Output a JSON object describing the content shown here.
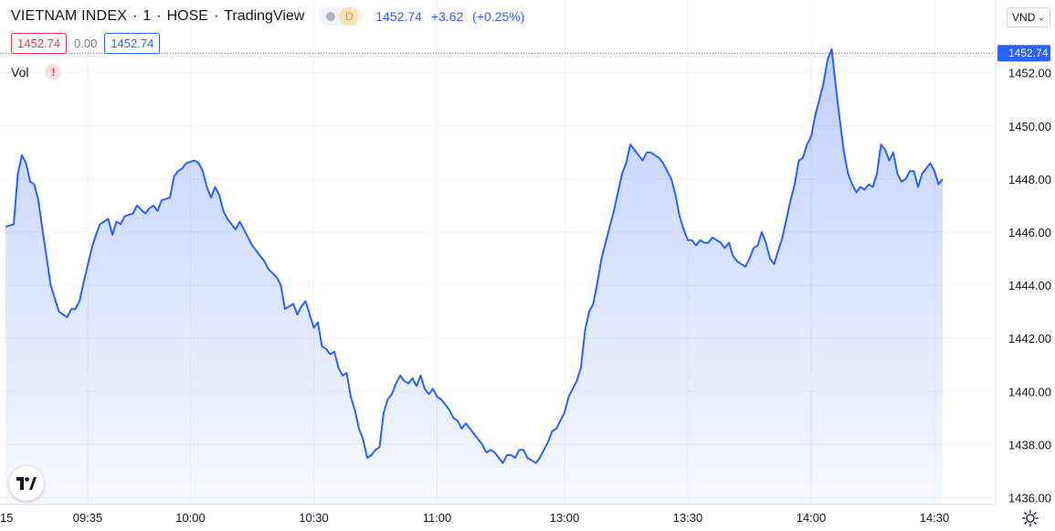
{
  "header": {
    "symbol": "VIETNAM INDEX",
    "interval": "1",
    "exchange": "HOSE",
    "provider": "TradingView",
    "badge_d": "D",
    "last": "1452.74",
    "change": "+3.62",
    "change_pct": "(+0.25%)",
    "price_box_red": "1452.74",
    "zero": "0.00",
    "price_box_blue": "1452.74",
    "vol_label": "Vol",
    "vol_warn": "!",
    "currency": "VND"
  },
  "colors": {
    "line": "#2962ff",
    "fill_top": "#2962ff",
    "grid": "#f0f3fa",
    "last_line": "#2962ff"
  },
  "chart_data": {
    "type": "area",
    "ylim": [
      1436.0,
      1453.2
    ],
    "y_ticks": [
      "1436.00",
      "1438.00",
      "1440.00",
      "1442.00",
      "1444.00",
      "1446.00",
      "1448.00",
      "1450.00",
      "1452.00"
    ],
    "x_ticks": [
      {
        "label": "15",
        "t": 0
      },
      {
        "label": "09:35",
        "t": 20
      },
      {
        "label": "10:00",
        "t": 45
      },
      {
        "label": "10:30",
        "t": 75
      },
      {
        "label": "11:00",
        "t": 105
      },
      {
        "label": "13:00",
        "t": 136
      },
      {
        "label": "13:30",
        "t": 166
      },
      {
        "label": "14:00",
        "t": 196
      },
      {
        "label": "14:30",
        "t": 226
      }
    ],
    "last_value_label": "1452.74",
    "last_value": 1452.74,
    "x": [
      0,
      2,
      3,
      4,
      5,
      6,
      7,
      8,
      9,
      11,
      13,
      15,
      16,
      17,
      18,
      19,
      21,
      22,
      23,
      25,
      26,
      27,
      28,
      29,
      31,
      32,
      34,
      35,
      36,
      37,
      38,
      40,
      41,
      42,
      43,
      44,
      46,
      47,
      48,
      49,
      50,
      51,
      52,
      53,
      54,
      56,
      57,
      58,
      59,
      60,
      61,
      62,
      63,
      64,
      66,
      67,
      68,
      69,
      70,
      71,
      72,
      73,
      75,
      76,
      77,
      78,
      79,
      80,
      81,
      82,
      83,
      84,
      85,
      86,
      87,
      88,
      89,
      90,
      91,
      92,
      93,
      94,
      95,
      96,
      97,
      98,
      99,
      100,
      101,
      102,
      103,
      104,
      105,
      106,
      107,
      108,
      109,
      110,
      111,
      112,
      113,
      114,
      115,
      116,
      117,
      118,
      119,
      120,
      121,
      122,
      123,
      124,
      125,
      126,
      127,
      128,
      129,
      130,
      131,
      132,
      133,
      134,
      135,
      136,
      137,
      138,
      139,
      140,
      141,
      142,
      143,
      144,
      145,
      146,
      147,
      148,
      149,
      150,
      151,
      152,
      153,
      154,
      155,
      156,
      157,
      158,
      159,
      160,
      161,
      162,
      163,
      164,
      165,
      166,
      167,
      168,
      169,
      170,
      171,
      172,
      173,
      174,
      175,
      176,
      177,
      178,
      179,
      180,
      181,
      182,
      183,
      184,
      185,
      186,
      187,
      188,
      189,
      190,
      191,
      192,
      193,
      194,
      195,
      196,
      197,
      198,
      199,
      200,
      201,
      202,
      203,
      204,
      205,
      206,
      207,
      208,
      209,
      210,
      211,
      212,
      213,
      214,
      215,
      216,
      217,
      218,
      219,
      220,
      221,
      222,
      223,
      224,
      225,
      226,
      227,
      228
    ],
    "values": [
      1446.2,
      1446.3,
      1448.2,
      1448.9,
      1448.6,
      1447.9,
      1447.8,
      1447.2,
      1446.1,
      1444.0,
      1443.0,
      1442.8,
      1443.1,
      1443.1,
      1443.4,
      1444.1,
      1445.4,
      1445.9,
      1446.3,
      1446.5,
      1445.9,
      1446.4,
      1446.3,
      1446.6,
      1446.7,
      1447.0,
      1446.7,
      1446.9,
      1447.0,
      1446.8,
      1447.2,
      1447.3,
      1448.1,
      1448.3,
      1448.4,
      1448.6,
      1448.7,
      1448.6,
      1448.3,
      1447.7,
      1447.3,
      1447.7,
      1447.4,
      1446.8,
      1446.5,
      1446.1,
      1446.4,
      1446.1,
      1445.8,
      1445.5,
      1445.3,
      1445.1,
      1444.9,
      1444.6,
      1444.3,
      1444.0,
      1443.1,
      1443.2,
      1443.3,
      1442.9,
      1443.2,
      1443.4,
      1442.4,
      1442.6,
      1441.7,
      1441.6,
      1441.4,
      1441.5,
      1440.9,
      1440.6,
      1440.7,
      1439.8,
      1439.3,
      1438.6,
      1438.2,
      1437.5,
      1437.6,
      1437.8,
      1437.9,
      1439.2,
      1439.7,
      1439.9,
      1440.3,
      1440.6,
      1440.4,
      1440.3,
      1440.5,
      1440.2,
      1440.6,
      1440.1,
      1439.9,
      1440.1,
      1439.8,
      1439.7,
      1439.5,
      1439.3,
      1439.0,
      1438.9,
      1438.6,
      1438.8,
      1438.6,
      1438.4,
      1438.2,
      1438.0,
      1437.7,
      1437.8,
      1437.7,
      1437.5,
      1437.3,
      1437.6,
      1437.6,
      1437.5,
      1437.8,
      1437.8,
      1437.5,
      1437.4,
      1437.3,
      1437.5,
      1437.8,
      1438.1,
      1438.5,
      1438.6,
      1438.9,
      1439.2,
      1439.8,
      1440.1,
      1440.4,
      1440.9,
      1442.3,
      1443.0,
      1443.3,
      1444.1,
      1445.0,
      1445.6,
      1446.2,
      1446.8,
      1447.5,
      1448.2,
      1448.6,
      1449.3,
      1449.1,
      1448.9,
      1448.7,
      1449.0,
      1449.0,
      1448.9,
      1448.8,
      1448.6,
      1448.3,
      1448.0,
      1447.4,
      1446.6,
      1446.1,
      1445.7,
      1445.7,
      1445.5,
      1445.7,
      1445.6,
      1445.6,
      1445.8,
      1445.7,
      1445.6,
      1445.4,
      1445.6,
      1445.1,
      1444.9,
      1444.8,
      1444.7,
      1445.0,
      1445.4,
      1445.5,
      1446.0,
      1445.6,
      1445.0,
      1444.8,
      1445.3,
      1445.8,
      1446.5,
      1447.2,
      1447.8,
      1448.7,
      1448.8,
      1449.3,
      1449.6,
      1450.4,
      1451.0,
      1451.6,
      1452.5,
      1452.9,
      1451.5,
      1450.2,
      1449.0,
      1448.2,
      1447.8,
      1447.5,
      1447.7,
      1447.6,
      1447.8,
      1447.7,
      1448.2,
      1449.3,
      1449.1,
      1448.7,
      1449.0,
      1448.2,
      1447.9,
      1448.0,
      1448.3,
      1448.3,
      1447.7,
      1448.2,
      1448.4,
      1448.6,
      1448.3,
      1447.8,
      1448.0,
      1447.9,
      1449.1,
      1452.74
    ]
  }
}
